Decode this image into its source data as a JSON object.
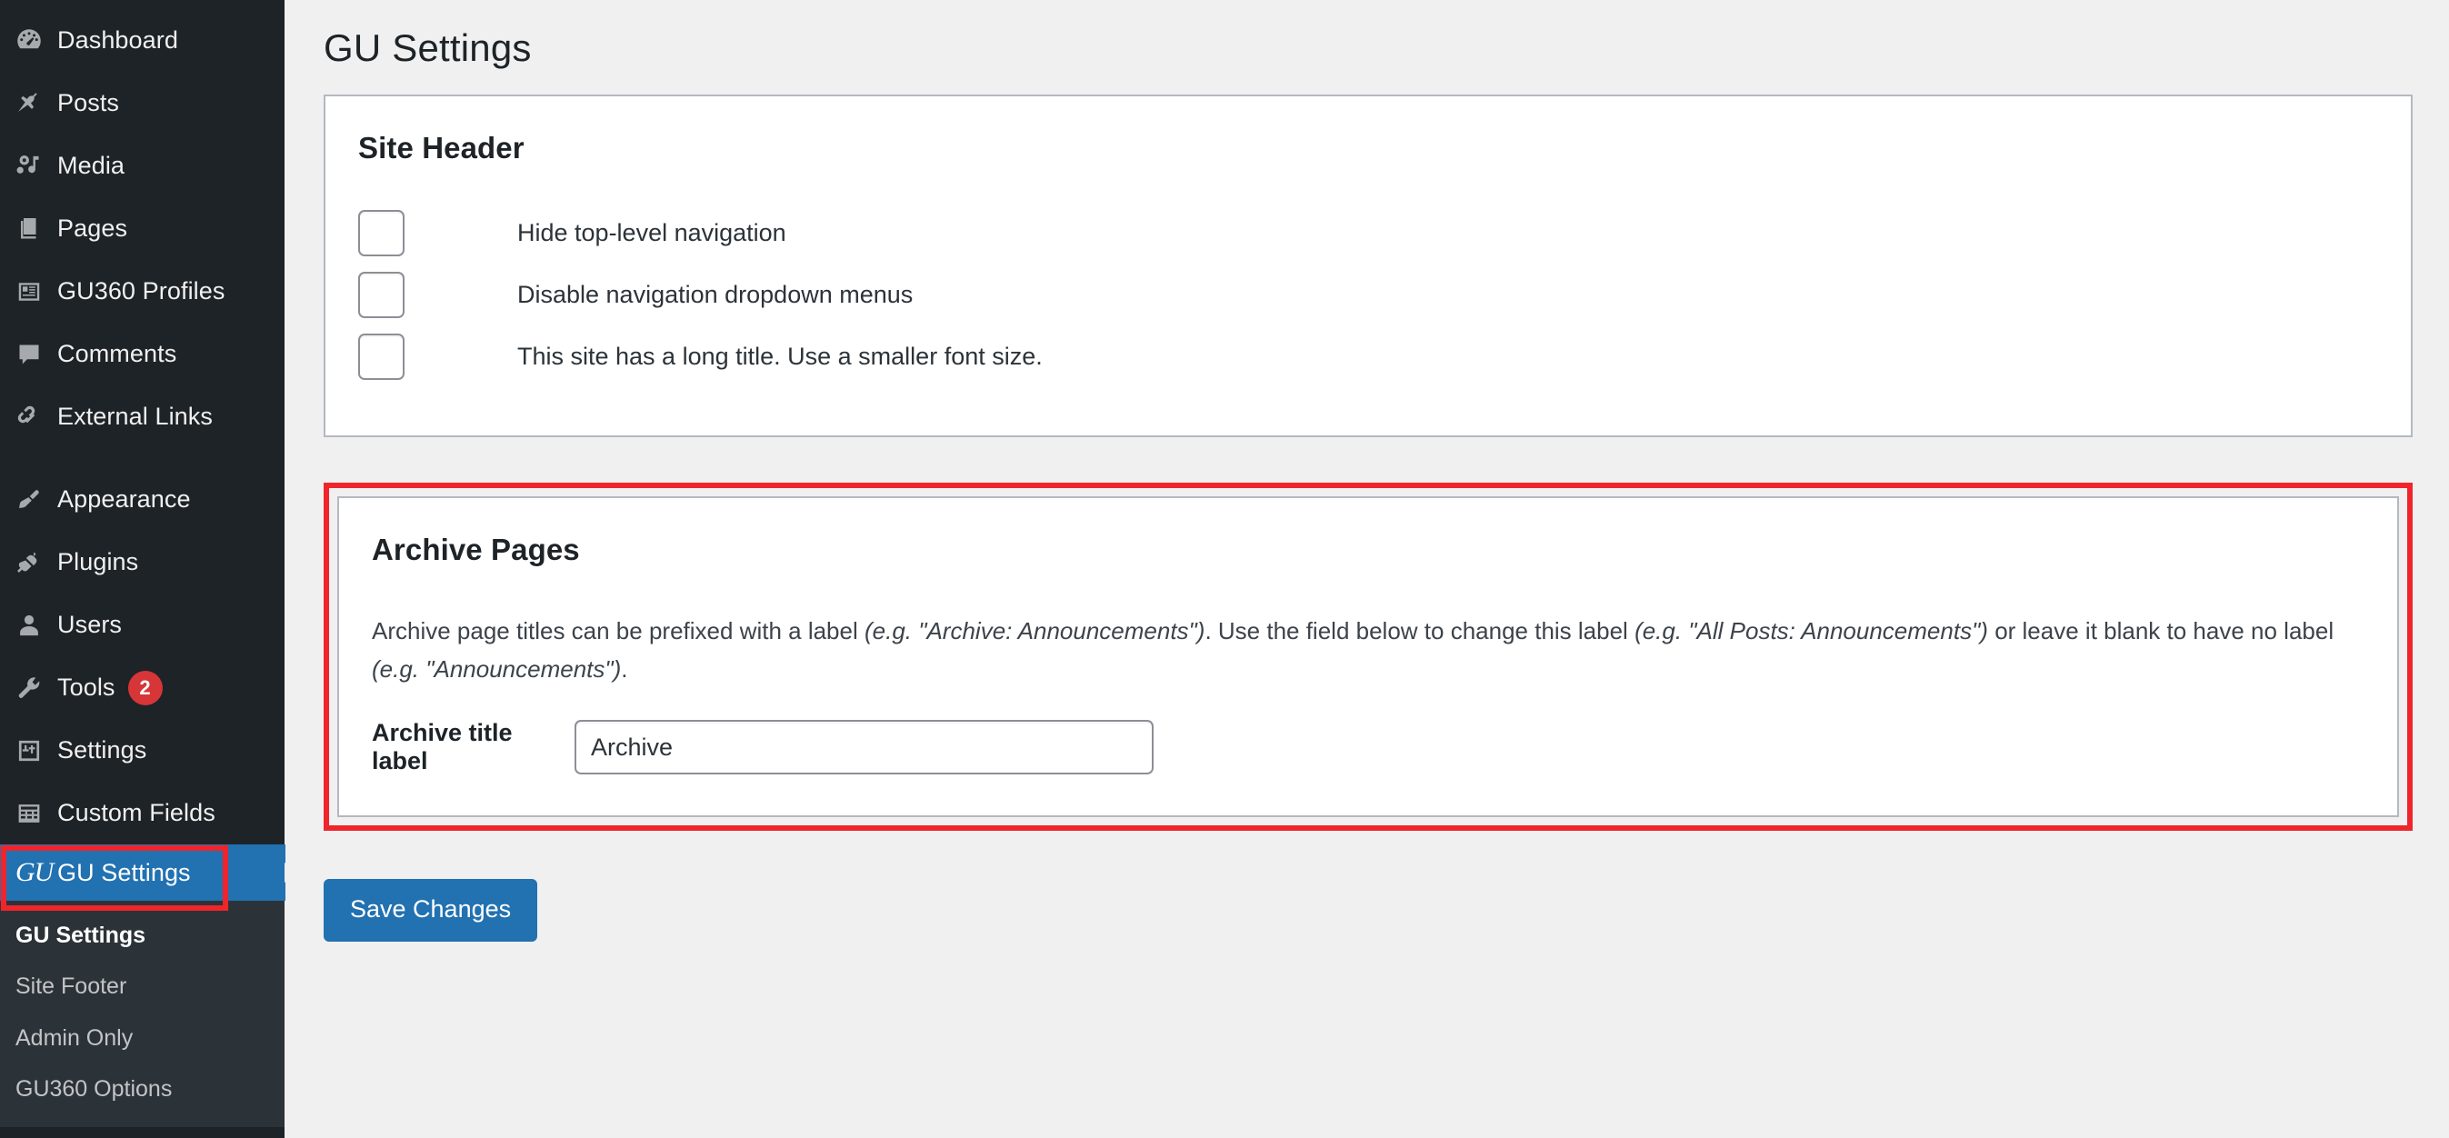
{
  "sidebar": {
    "items": [
      {
        "label": "Dashboard",
        "icon": "dashboard-icon",
        "name": "sidebar-item-dashboard"
      },
      {
        "label": "Posts",
        "icon": "pin-icon",
        "name": "sidebar-item-posts"
      },
      {
        "label": "Media",
        "icon": "media-icon",
        "name": "sidebar-item-media"
      },
      {
        "label": "Pages",
        "icon": "pages-icon",
        "name": "sidebar-item-pages"
      },
      {
        "label": "GU360 Profiles",
        "icon": "id-card-icon",
        "name": "sidebar-item-gu360-profiles"
      },
      {
        "label": "Comments",
        "icon": "comment-icon",
        "name": "sidebar-item-comments"
      },
      {
        "label": "External Links",
        "icon": "link-icon",
        "name": "sidebar-item-external-links"
      },
      {
        "label": "Appearance",
        "icon": "paintbrush-icon",
        "name": "sidebar-item-appearance"
      },
      {
        "label": "Plugins",
        "icon": "plug-icon",
        "name": "sidebar-item-plugins"
      },
      {
        "label": "Users",
        "icon": "user-icon",
        "name": "sidebar-item-users"
      },
      {
        "label": "Tools",
        "icon": "wrench-icon",
        "name": "sidebar-item-tools",
        "badge": "2"
      },
      {
        "label": "Settings",
        "icon": "sliders-icon",
        "name": "sidebar-item-settings"
      },
      {
        "label": "Custom Fields",
        "icon": "table-icon",
        "name": "sidebar-item-custom-fields"
      },
      {
        "label": "GU Settings",
        "icon": "gu-logo-icon",
        "name": "sidebar-item-gu-settings",
        "current": true
      }
    ],
    "submenu": [
      {
        "label": "GU Settings",
        "name": "submenu-item-gu-settings",
        "current": true
      },
      {
        "label": "Site Footer",
        "name": "submenu-item-site-footer"
      },
      {
        "label": "Admin Only",
        "name": "submenu-item-admin-only"
      },
      {
        "label": "GU360 Options",
        "name": "submenu-item-gu360-options"
      }
    ]
  },
  "page": {
    "title": "GU Settings"
  },
  "site_header": {
    "title": "Site Header",
    "checkboxes": [
      {
        "label": "Hide top-level navigation",
        "checked": false,
        "name": "checkbox-hide-top-level-navigation"
      },
      {
        "label": "Disable navigation dropdown menus",
        "checked": false,
        "name": "checkbox-disable-navigation-dropdown-menus"
      },
      {
        "label": "This site has a long title. Use a smaller font size.",
        "checked": false,
        "name": "checkbox-smaller-font-size"
      }
    ]
  },
  "archive_pages": {
    "title": "Archive Pages",
    "description": {
      "part1": "Archive page titles can be prefixed with a label ",
      "em1": "(e.g. \"Archive: Announcements\")",
      "part2": ". Use the field below to change this label ",
      "em2": "(e.g. \"All Posts: Announcements\")",
      "part3": " or leave it blank to have no label ",
      "em3": "(e.g. \"Announcements\")",
      "part4": "."
    },
    "field_label": "Archive title label",
    "field_value": "Archive",
    "field_placeholder": ""
  },
  "actions": {
    "save_label": "Save Changes"
  },
  "colors": {
    "sidebar_bg": "#1d2327",
    "submenu_bg": "#2c3338",
    "accent_blue": "#2271b1",
    "badge_red": "#d63638",
    "annotation_red": "#f0252b",
    "content_bg": "#f0f0f1",
    "panel_border": "#b4b9be"
  }
}
